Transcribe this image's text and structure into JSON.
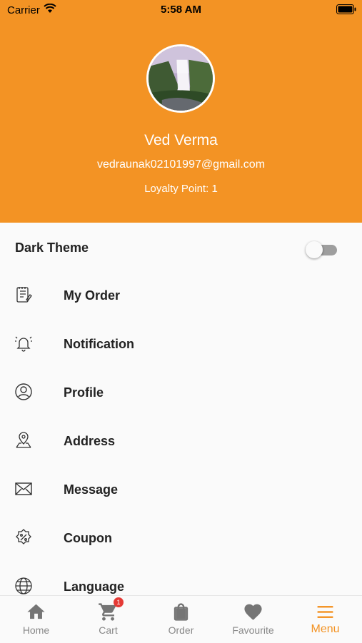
{
  "status_bar": {
    "carrier": "Carrier",
    "time": "5:58 AM"
  },
  "profile": {
    "name": "Ved Verma",
    "email": "vedraunak02101997@gmail.com",
    "loyalty": "Loyalty Point: 1"
  },
  "settings": {
    "dark_theme_label": "Dark Theme",
    "dark_theme_on": false
  },
  "menu": {
    "items": [
      {
        "label": "My Order",
        "icon": "order-list-icon"
      },
      {
        "label": "Notification",
        "icon": "bell-icon"
      },
      {
        "label": "Profile",
        "icon": "user-circle-icon"
      },
      {
        "label": "Address",
        "icon": "map-pin-icon"
      },
      {
        "label": "Message",
        "icon": "envelope-icon"
      },
      {
        "label": "Coupon",
        "icon": "coupon-icon"
      },
      {
        "label": "Language",
        "icon": "globe-icon"
      }
    ]
  },
  "bottom_nav": {
    "items": [
      {
        "label": "Home",
        "icon": "home-icon"
      },
      {
        "label": "Cart",
        "icon": "cart-icon",
        "badge": "1"
      },
      {
        "label": "Order",
        "icon": "shopping-bag-icon"
      },
      {
        "label": "Favourite",
        "icon": "heart-icon"
      },
      {
        "label": "Menu",
        "icon": "menu-icon",
        "active": true
      }
    ]
  },
  "colors": {
    "accent": "#f39324",
    "badge": "#e53935",
    "inactive": "#888888"
  }
}
